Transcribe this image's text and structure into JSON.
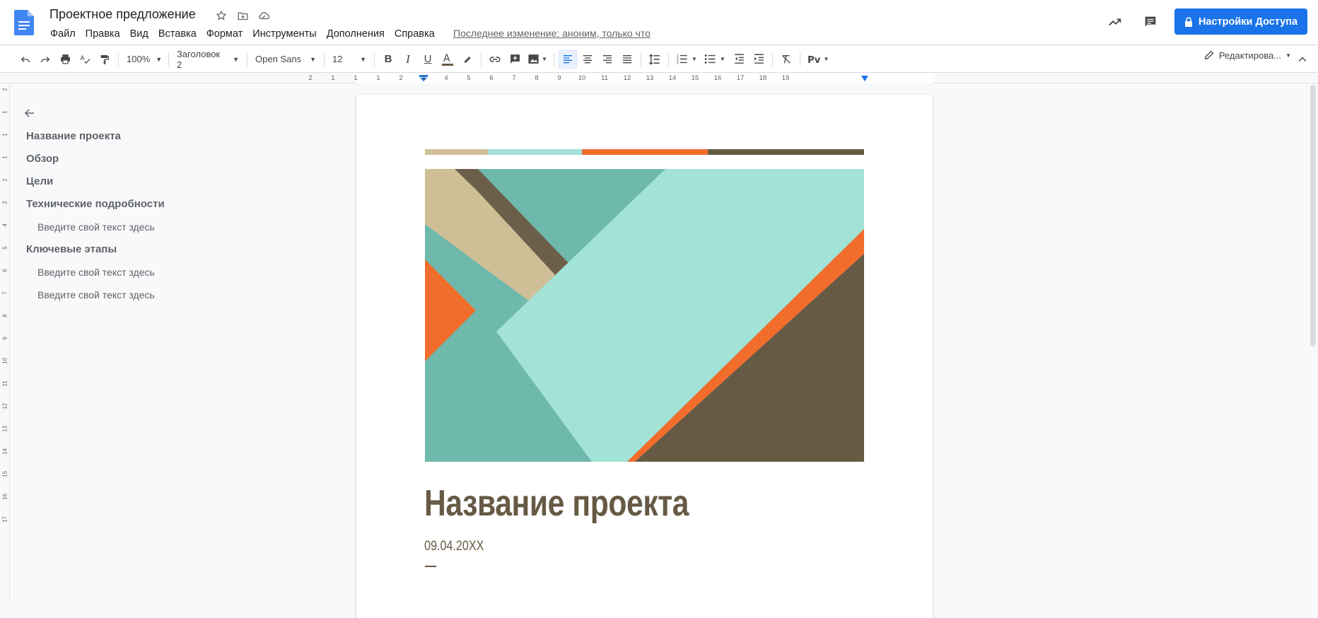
{
  "doc": {
    "title": "Проектное предложение",
    "last_edit": "Последнее изменение: аноним, только что"
  },
  "menu": [
    "Файл",
    "Правка",
    "Вид",
    "Вставка",
    "Формат",
    "Инструменты",
    "Дополнения",
    "Справка"
  ],
  "share": {
    "label": "Настройки Доступа",
    "color": "#1a73e8"
  },
  "toolbar": {
    "zoom": "100%",
    "style": "Заголовок 2",
    "font": "Open Sans",
    "size": "12",
    "mode": "Редактирова..."
  },
  "ruler": [
    "2",
    "1",
    "1",
    "1",
    "2",
    "3",
    "4",
    "5",
    "6",
    "7",
    "8",
    "9",
    "10",
    "11",
    "12",
    "13",
    "14",
    "15",
    "16",
    "17",
    "18",
    "19"
  ],
  "vruler": [
    "2",
    "1",
    "1",
    "1",
    "2",
    "3",
    "4",
    "5",
    "6",
    "7",
    "8",
    "9",
    "10",
    "11",
    "12",
    "13",
    "14",
    "15",
    "16",
    "17"
  ],
  "outline": {
    "items": [
      {
        "label": "Название проекта",
        "level": 1
      },
      {
        "label": "Обзор",
        "level": 1
      },
      {
        "label": "Цели",
        "level": 1
      },
      {
        "label": "Технические подробности",
        "level": 1
      },
      {
        "label": "Введите свой текст здесь",
        "level": 2
      },
      {
        "label": "Ключевые этапы",
        "level": 1
      },
      {
        "label": "Введите свой текст здесь",
        "level": 2
      },
      {
        "label": "Введите свой текст здесь",
        "level": 2
      }
    ]
  },
  "page": {
    "heading": "Название проекта",
    "date": "09.04.20XX",
    "stripe_colors": [
      "#cfbf96",
      "#a2e2d7",
      "#f26d2c",
      "#665a45"
    ],
    "accent_color": "#665a45"
  }
}
